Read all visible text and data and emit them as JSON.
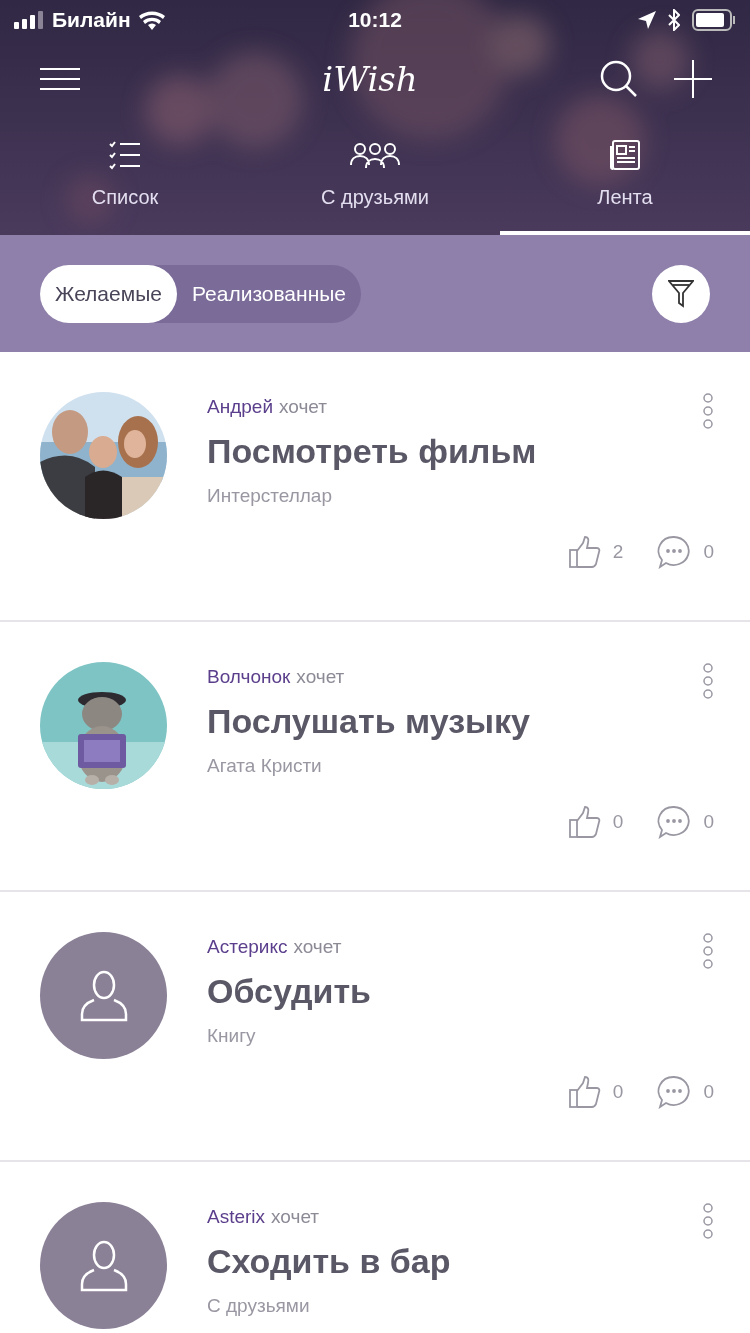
{
  "status_bar": {
    "carrier": "Билайн",
    "time": "10:12"
  },
  "header": {
    "title": "iWish"
  },
  "tabs": [
    {
      "label": "Список",
      "selected": false
    },
    {
      "label": "С друзьями",
      "selected": false
    },
    {
      "label": "Лента",
      "selected": true
    }
  ],
  "segments": [
    {
      "label": "Желаемые",
      "selected": true
    },
    {
      "label": "Реализованные",
      "selected": false
    }
  ],
  "feed": [
    {
      "author": "Андрей",
      "verb": "хочет",
      "title": "Посмотреть фильм",
      "subtitle": "Интерстеллар",
      "likes": "2",
      "comments": "0"
    },
    {
      "author": "Волчонок",
      "verb": "хочет",
      "title": "Послушать музыку",
      "subtitle": "Агата Кристи",
      "likes": "0",
      "comments": "0"
    },
    {
      "avatar": {
        "kind": "placeholder"
      },
      "author": "Астерикс",
      "verb": "хочет",
      "title": "Обсудить",
      "subtitle": "Книгу",
      "likes": "0",
      "comments": "0"
    },
    {
      "avatar": {
        "kind": "placeholder"
      },
      "author": "Asterix",
      "verb": "хочет",
      "title": "Сходить в бар",
      "subtitle": "С друзьями"
    }
  ]
}
